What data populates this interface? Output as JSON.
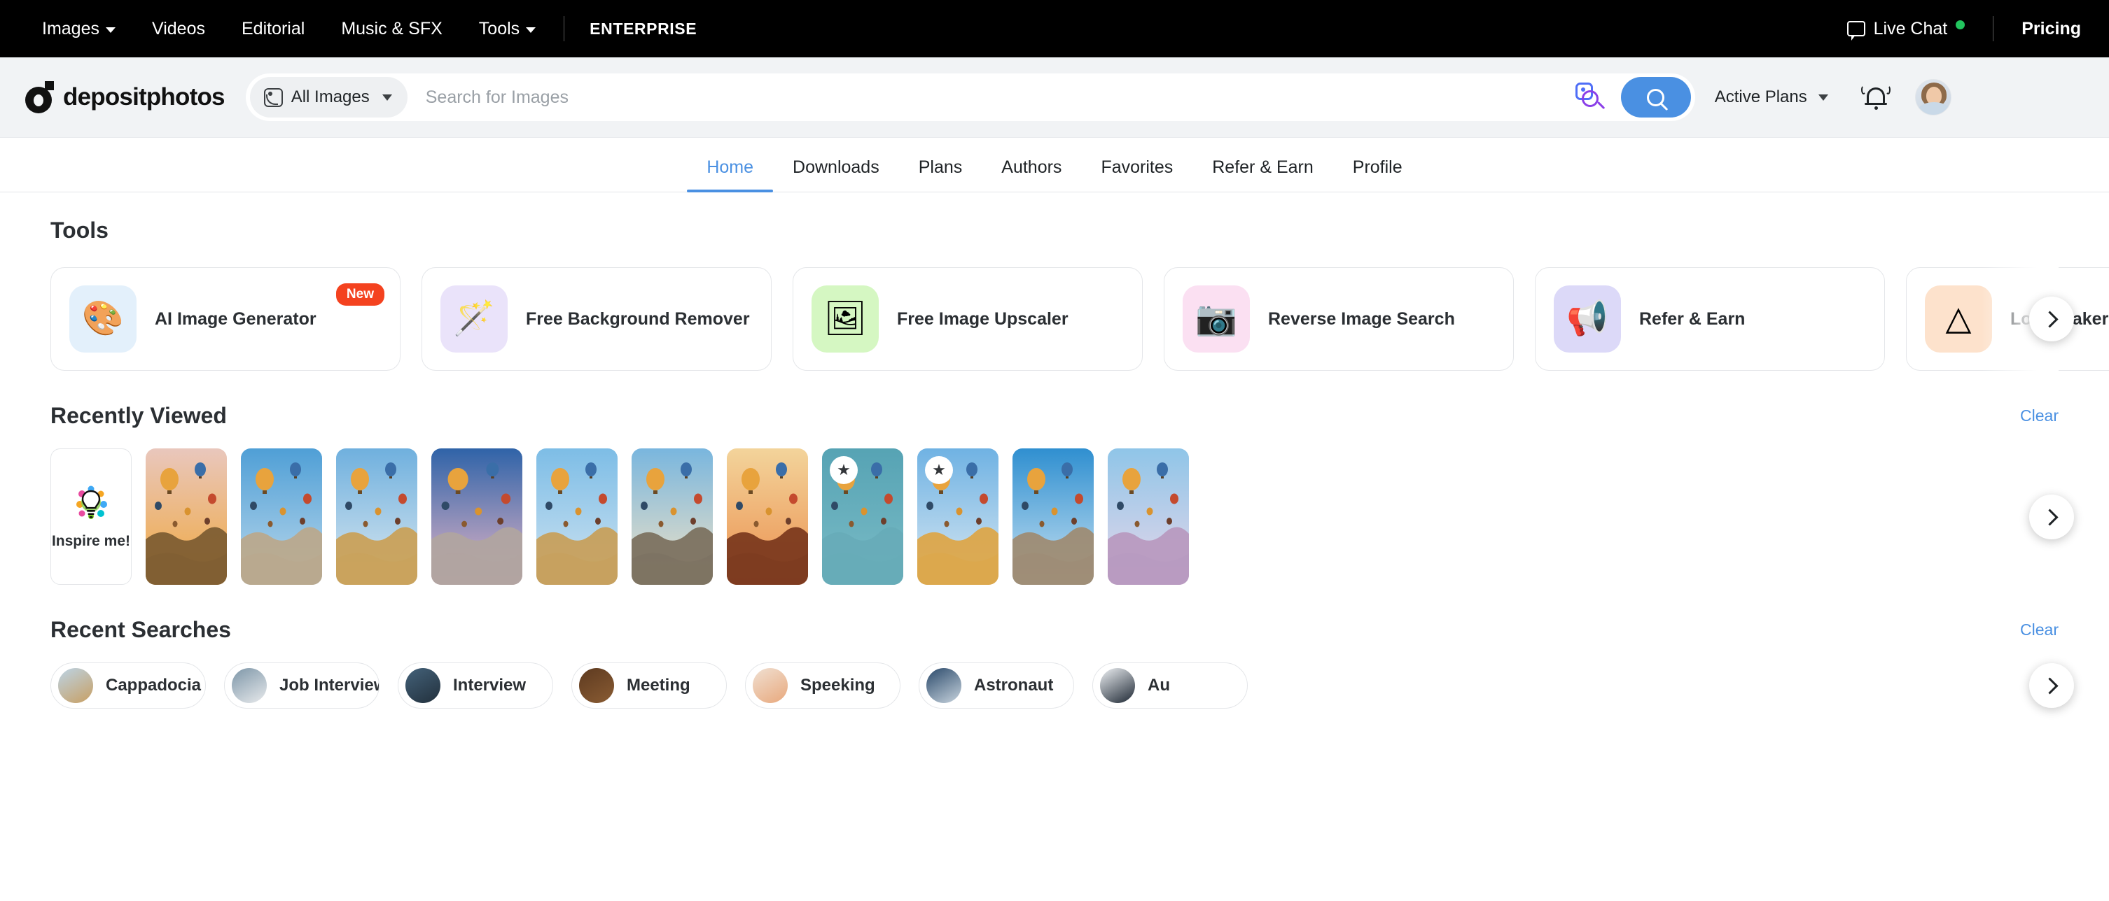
{
  "topbar": {
    "nav": [
      {
        "label": "Images",
        "has_caret": true
      },
      {
        "label": "Videos",
        "has_caret": false
      },
      {
        "label": "Editorial",
        "has_caret": false
      },
      {
        "label": "Music & SFX",
        "has_caret": false
      },
      {
        "label": "Tools",
        "has_caret": true
      }
    ],
    "enterprise": "ENTERPRISE",
    "live_chat": "Live Chat",
    "live_chat_status_color": "#22c55e",
    "pricing": "Pricing"
  },
  "header": {
    "logo_text": "depositphotos",
    "category": "All Images",
    "search_placeholder": "Search for Images",
    "search_value": "",
    "active_plans": "Active Plans",
    "icons": {
      "reverse_search": "reverse-image-search-icon",
      "search": "search-icon",
      "notifications": "bell-icon",
      "avatar": "user-avatar"
    }
  },
  "tabs": [
    {
      "label": "Home",
      "active": true
    },
    {
      "label": "Downloads",
      "active": false
    },
    {
      "label": "Plans",
      "active": false
    },
    {
      "label": "Authors",
      "active": false
    },
    {
      "label": "Favorites",
      "active": false
    },
    {
      "label": "Refer & Earn",
      "active": false
    },
    {
      "label": "Profile",
      "active": false
    }
  ],
  "accent_color": "#4a90e2",
  "tools": {
    "title": "Tools",
    "items": [
      {
        "label": "AI Image Generator",
        "badge": "New",
        "icon": "ai-sparkle-icon",
        "icon_bg": "#e3f0fb",
        "glyph": "🎨"
      },
      {
        "label": "Free Background Remover",
        "badge": "",
        "icon": "magic-wand-icon",
        "icon_bg": "#eae3fa",
        "glyph": "🪄"
      },
      {
        "label": "Free Image Upscaler",
        "badge": "",
        "icon": "upscale-icon",
        "icon_bg": "#d5f7c2",
        "glyph": "🖼"
      },
      {
        "label": "Reverse Image Search",
        "badge": "",
        "icon": "camera-globe-icon",
        "icon_bg": "#fbe0f2",
        "glyph": "📷"
      },
      {
        "label": "Refer & Earn",
        "badge": "",
        "icon": "megaphone-icon",
        "icon_bg": "#dcd9f8",
        "glyph": "📢"
      },
      {
        "label": "Logo Maker",
        "badge": "",
        "icon": "shapes-icon",
        "icon_bg": "#fde2cc",
        "glyph": "△"
      }
    ]
  },
  "recently_viewed": {
    "title": "Recently Viewed",
    "clear_label": "Clear",
    "inspire_label": "Inspire me!",
    "items": [
      {
        "name": "cappadocia-balloons-sunset-1",
        "width": 116,
        "starred": false,
        "sky_top": "#e9c7bd",
        "sky_bottom": "#f0a83e",
        "ground": "#7e5e33"
      },
      {
        "name": "cappadocia-valley-blue-sky-2",
        "width": 116,
        "starred": false,
        "sky_top": "#4f9fd6",
        "sky_bottom": "#bcd9ec",
        "ground": "#b9a98d"
      },
      {
        "name": "cappadocia-rocks-clouds-3",
        "width": 116,
        "starred": false,
        "sky_top": "#6fb0de",
        "sky_bottom": "#dbe8f0",
        "ground": "#c9a15a"
      },
      {
        "name": "cappadocia-pink-valley-4",
        "width": 130,
        "starred": false,
        "sky_top": "#2f63a8",
        "sky_bottom": "#e7b7c8",
        "ground": "#b0a4a0"
      },
      {
        "name": "cappadocia-cave-view-5",
        "width": 116,
        "starred": false,
        "sky_top": "#7dbde6",
        "sky_bottom": "#cfe3f1",
        "ground": "#c7a05c"
      },
      {
        "name": "cappadocia-sunrise-fairy-chimneys-6",
        "width": 116,
        "starred": false,
        "sky_top": "#79b6de",
        "sky_bottom": "#f2e3c6",
        "ground": "#7c7260"
      },
      {
        "name": "cappadocia-orange-sunrise-7",
        "width": 116,
        "starred": false,
        "sky_top": "#f3d49b",
        "sky_bottom": "#eb8f4e",
        "ground": "#7c3a1f"
      },
      {
        "name": "ferris-wheel-teal-sky-8",
        "width": 116,
        "starred": true,
        "sky_top": "#56a3b4",
        "sky_bottom": "#7bbcc6",
        "ground": "#67acb8"
      },
      {
        "name": "balloon-over-golden-rocks-9",
        "width": 116,
        "starred": true,
        "sky_top": "#6fb2e3",
        "sky_bottom": "#d9e8f2",
        "ground": "#dca74a"
      },
      {
        "name": "balloons-blue-sky-clouds-10",
        "width": 116,
        "starred": false,
        "sky_top": "#2f8fd0",
        "sky_bottom": "#c8e2f2",
        "ground": "#9e8c74"
      },
      {
        "name": "balloons-purple-valley-11",
        "width": 116,
        "starred": false,
        "sky_top": "#8fc5e8",
        "sky_bottom": "#e7d7ea",
        "ground": "#b89ac0"
      }
    ]
  },
  "recent_searches": {
    "title": "Recent Searches",
    "clear_label": "Clear",
    "items": [
      {
        "label": "Cappadocia",
        "thumb": "cappadocia-thumb",
        "c1": "#bcd4e6",
        "c2": "#c89f62"
      },
      {
        "label": "Job Interview",
        "thumb": "job-interview-thumb",
        "c1": "#7d96a8",
        "c2": "#e8eaec"
      },
      {
        "label": "Interview",
        "thumb": "interview-thumb",
        "c1": "#44627a",
        "c2": "#22303c"
      },
      {
        "label": "Meeting",
        "thumb": "meeting-thumb",
        "c1": "#5d3a20",
        "c2": "#8a5c33"
      },
      {
        "label": "Speeking",
        "thumb": "speaking-thumb",
        "c1": "#f0e0d2",
        "c2": "#e8a87c"
      },
      {
        "label": "Astronaut",
        "thumb": "astronaut-thumb",
        "c1": "#2b4a6b",
        "c2": "#c8d4de"
      },
      {
        "label": "Au",
        "thumb": "astronaut-suit-thumb",
        "c1": "#eef1f4",
        "c2": "#1d2733"
      }
    ]
  }
}
